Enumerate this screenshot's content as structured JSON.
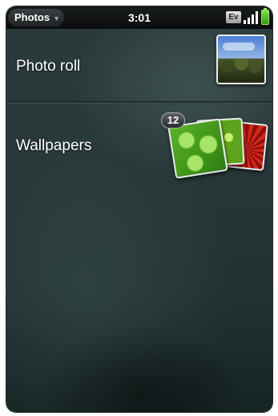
{
  "status_bar": {
    "app_menu_label": "Photos",
    "app_menu_caret": "▼",
    "time": "3:01",
    "network_badge": "Ev",
    "signal_icon": "signal-bars-icon",
    "battery_icon": "battery-icon",
    "battery_color": "#4fc22a"
  },
  "albums": [
    {
      "label": "Photo roll",
      "thumbnail_icon": "landscape-photo-thumbnail"
    },
    {
      "label": "Wallpapers",
      "count": "12",
      "thumbnail_icon": "stacked-wallpaper-thumbnails"
    }
  ]
}
